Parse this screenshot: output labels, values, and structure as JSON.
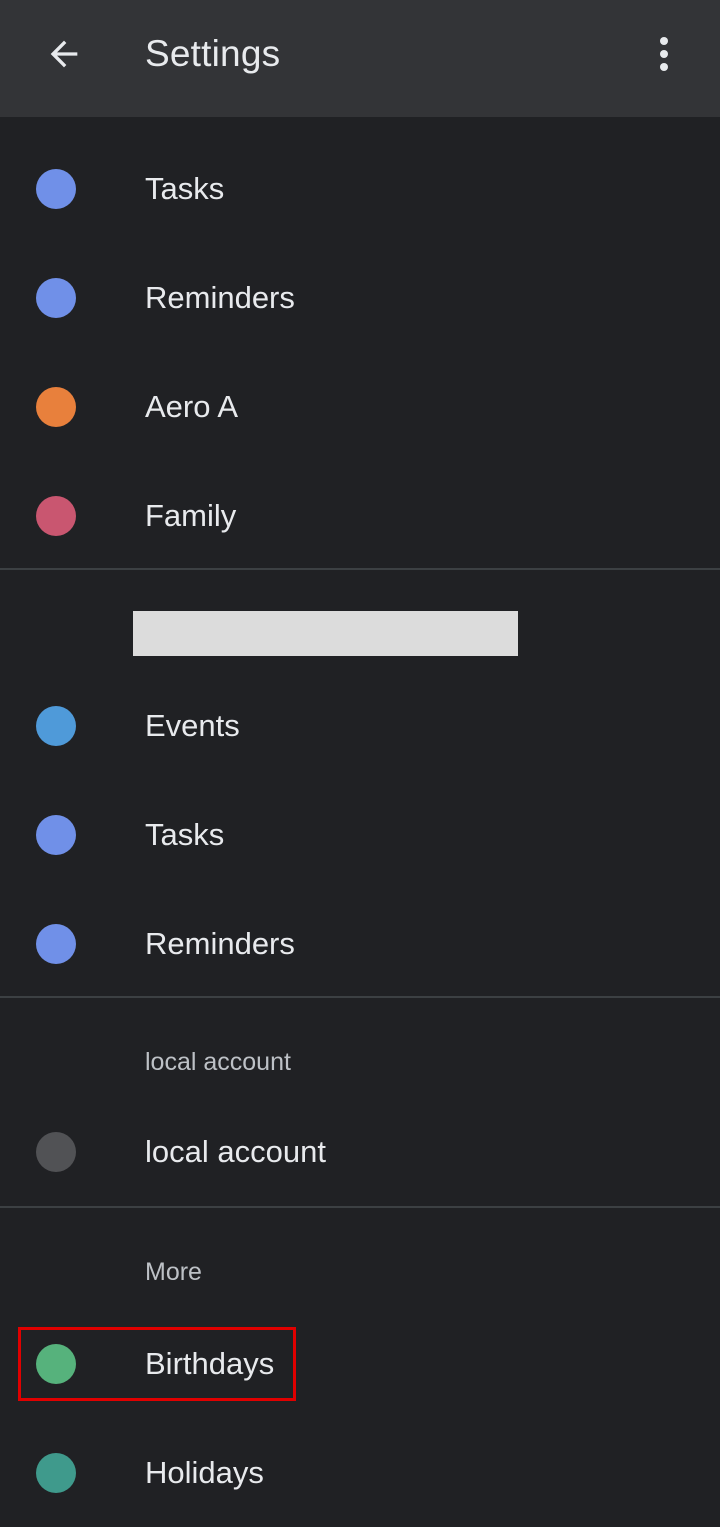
{
  "app_bar": {
    "title": "Settings",
    "back_icon": "arrow-back-icon",
    "menu_icon": "more-vert-icon"
  },
  "accounts": [
    {
      "header": "",
      "items": [
        {
          "label": "Tasks",
          "color": "#7090e8"
        },
        {
          "label": "Reminders",
          "color": "#7090e8"
        },
        {
          "label": "Aero A",
          "color": "#e8803c"
        },
        {
          "label": "Family",
          "color": "#c95670"
        }
      ]
    },
    {
      "header": "",
      "items": [
        {
          "label": "Events",
          "color": "#4f9ad9"
        },
        {
          "label": "Tasks",
          "color": "#7090e8"
        },
        {
          "label": "Reminders",
          "color": "#7090e8"
        }
      ]
    },
    {
      "header": "local account",
      "items": [
        {
          "label": "local account",
          "color": "#515255"
        }
      ]
    },
    {
      "header": "More",
      "items": [
        {
          "label": "Birthdays",
          "color": "#56b27c"
        },
        {
          "label": "Holidays",
          "color": "#3f9a8c"
        }
      ]
    }
  ],
  "colors": {
    "background": "#202124",
    "app_bar": "#333437",
    "highlight": "#e00000"
  }
}
